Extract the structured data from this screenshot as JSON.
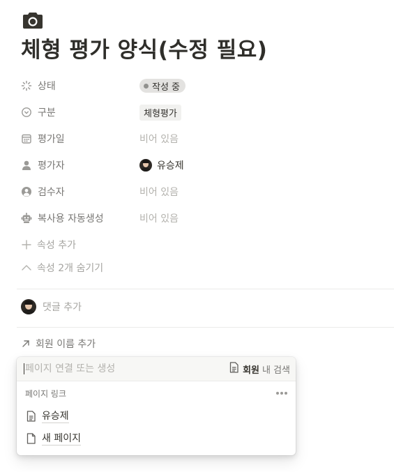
{
  "page": {
    "icon": "camera-icon",
    "title": "체형 평가 양식(수정 필요)"
  },
  "properties": [
    {
      "key": "상태",
      "icon": "status-icon",
      "value": "작성 중",
      "kind": "status",
      "status_color": "#91918e"
    },
    {
      "key": "구분",
      "icon": "select-icon",
      "value": "체형평가",
      "kind": "tag"
    },
    {
      "key": "평가일",
      "icon": "calendar-icon",
      "value": "비어 있음",
      "kind": "empty"
    },
    {
      "key": "평가자",
      "icon": "person-icon",
      "value": "유승제",
      "kind": "person"
    },
    {
      "key": "검수자",
      "icon": "person-circle-icon",
      "value": "비어 있음",
      "kind": "empty"
    },
    {
      "key": "복사용 자동생성",
      "icon": "robot-icon",
      "value": "비어 있음",
      "kind": "empty"
    }
  ],
  "actions": {
    "add_property": "속성 추가",
    "hide_properties": "속성 2개 숨기기"
  },
  "comment": {
    "placeholder": "댓글 추가"
  },
  "relation": {
    "label": "회원 이름 추가"
  },
  "popup": {
    "search_placeholder": "페이지 연결 또는 생성",
    "scope_db": "회원",
    "scope_suffix": "내 검색",
    "section_title": "페이지 링크",
    "items": [
      {
        "label": "유승제",
        "icon": "page-text-icon"
      },
      {
        "label": "새 페이지",
        "icon": "page-icon"
      }
    ]
  },
  "colors": {
    "text": "#37352f",
    "muted": "#787774",
    "empty": "#b3b2ad",
    "status_bg": "#e3e2e0",
    "tag_bg": "#f1f1ef"
  }
}
